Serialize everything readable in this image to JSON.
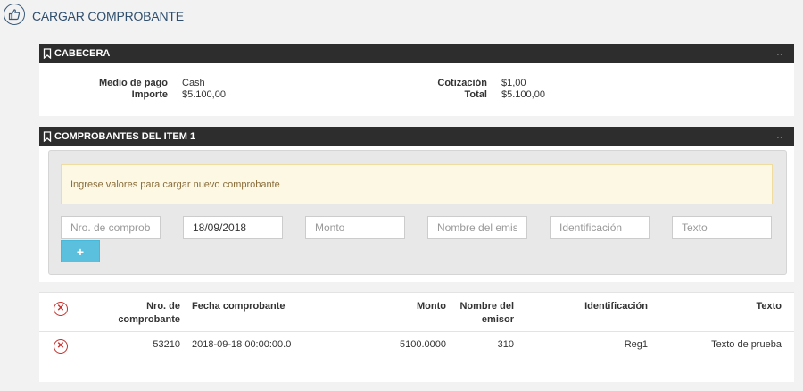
{
  "page": {
    "title": "CARGAR COMPROBANTE",
    "icon": "thumbs-up-icon"
  },
  "cabecera": {
    "title": "CABECERA",
    "medio_pago_label": "Medio de pago",
    "medio_pago_value": "Cash",
    "importe_label": "Importe",
    "importe_value": "$5.100,00",
    "cotizacion_label": "Cotización",
    "cotizacion_value": "$1,00",
    "total_label": "Total",
    "total_value": "$5.100,00"
  },
  "comprobantes": {
    "title": "COMPROBANTES DEL ITEM 1",
    "alert": "Ingrese valores para cargar nuevo comprobante",
    "form": {
      "nro_placeholder": "Nro. de comprobante",
      "fecha_value": "18/09/2018",
      "monto_placeholder": "Monto",
      "emisor_placeholder": "Nombre del emisor",
      "identificacion_placeholder": "Identificación",
      "texto_placeholder": "Texto",
      "add_label": "+"
    },
    "table": {
      "headers": {
        "nro_line1": "Nro. de",
        "nro_line2": "comprobante",
        "fecha": "Fecha comprobante",
        "monto": "Monto",
        "emisor_line1": "Nombre del",
        "emisor_line2": "emisor",
        "identificacion": "Identificación",
        "texto": "Texto"
      },
      "rows": [
        {
          "nro": "53210",
          "fecha": "2018-09-18 00:00:00.0",
          "monto": "5100.0000",
          "emisor": "310",
          "identificacion": "Reg1",
          "texto": "Texto de prueba"
        }
      ]
    }
  },
  "colors": {
    "title_blue": "#2f4e6e",
    "section_bar": "#2d2d2d",
    "alert_bg": "#fcf8e3",
    "alert_text": "#8a6d3b",
    "add_button": "#5bc0de",
    "delete_red": "#c9302c"
  }
}
